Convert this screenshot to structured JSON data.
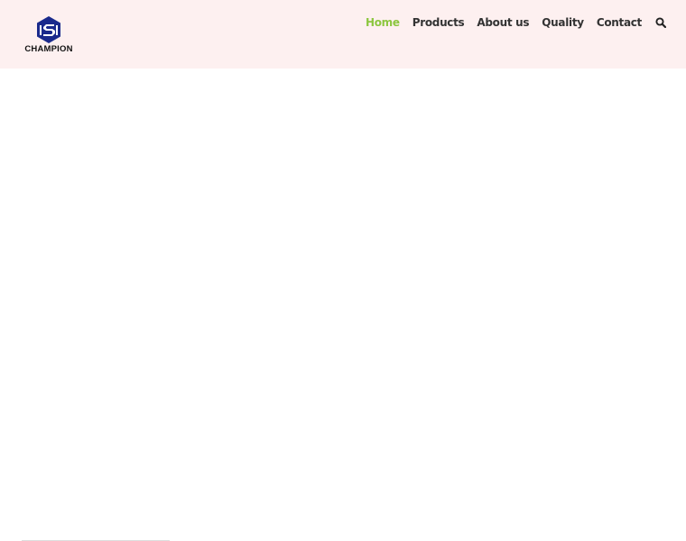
{
  "brand": {
    "logo_text": "CHAMPION",
    "logo_icon": "hexagon-s-logo",
    "logo_color": "#1a2a8c"
  },
  "nav": {
    "items": [
      {
        "label": "Home",
        "active": true
      },
      {
        "label": "Products",
        "active": false
      },
      {
        "label": "About us",
        "active": false
      },
      {
        "label": "Quality",
        "active": false
      },
      {
        "label": "Contact",
        "active": false
      }
    ],
    "search_icon": "search-icon"
  },
  "colors": {
    "header_bg": "#fdf0f0",
    "accent": "#8cc63f",
    "nav_text": "#333333"
  }
}
